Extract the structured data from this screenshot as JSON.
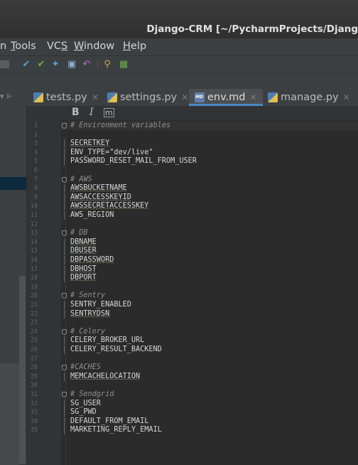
{
  "window": {
    "title": "Django-CRM [~/PycharmProjects/Djang"
  },
  "menu": [
    {
      "label": "n",
      "u": ""
    },
    {
      "label": "Tools",
      "u": "T"
    },
    {
      "label": "VCS",
      "u": "S"
    },
    {
      "label": "Window",
      "u": "W"
    },
    {
      "label": "Help",
      "u": "H"
    }
  ],
  "toolbar_icons": [
    "vcs-update-icon",
    "vcs-commit-icon",
    "vcs-push-icon",
    "vcs-history-icon",
    "vcs-revert-icon",
    "pull-request-icon",
    "shelve-icon"
  ],
  "tabs": [
    {
      "label": "tests.py",
      "type": "py",
      "active": false
    },
    {
      "label": "settings.py",
      "type": "py",
      "active": false
    },
    {
      "label": "env.md",
      "type": "md",
      "active": true
    },
    {
      "label": "manage.py",
      "type": "py",
      "active": false
    }
  ],
  "md_toolbar": {
    "bold": "B",
    "italic": "I",
    "code": "m"
  },
  "editor": {
    "lines": [
      {
        "n": "1",
        "t": "# Environment variables",
        "k": "hdr"
      },
      {
        "n": "2",
        "t": "",
        "k": ""
      },
      {
        "n": "3",
        "t": "SECRETKEY",
        "k": "key"
      },
      {
        "n": "4",
        "t": "ENV_TYPE=\"dev/live\"",
        "k": "key"
      },
      {
        "n": "5",
        "t": "PASSWORD_RESET_MAIL_FROM_USER",
        "k": "key"
      },
      {
        "n": "6",
        "t": "",
        "k": ""
      },
      {
        "n": "7",
        "t": "# AWS",
        "k": "hdr"
      },
      {
        "n": "8",
        "t": "AWSBUCKETNAME",
        "k": "key"
      },
      {
        "n": "9",
        "t": "AWSACCESSKEYID",
        "k": "key"
      },
      {
        "n": "10",
        "t": "AWSSECRETACCESSKEY",
        "k": "key"
      },
      {
        "n": "11",
        "t": "AWS_REGION",
        "k": "key"
      },
      {
        "n": "12",
        "t": "",
        "k": ""
      },
      {
        "n": "13",
        "t": "# DB",
        "k": "hdr"
      },
      {
        "n": "14",
        "t": "DBNAME",
        "k": "key"
      },
      {
        "n": "15",
        "t": "DBUSER",
        "k": "key"
      },
      {
        "n": "16",
        "t": "DBPASSWORD",
        "k": "key"
      },
      {
        "n": "17",
        "t": "DBHOST",
        "k": "key"
      },
      {
        "n": "18",
        "t": "DBPORT",
        "k": "key"
      },
      {
        "n": "19",
        "t": "",
        "k": ""
      },
      {
        "n": "20",
        "t": "# Sentry",
        "k": "hdr"
      },
      {
        "n": "21",
        "t": "SENTRY_ENABLED",
        "k": "key"
      },
      {
        "n": "22",
        "t": "SENTRYDSN",
        "k": "key"
      },
      {
        "n": "23",
        "t": "",
        "k": ""
      },
      {
        "n": "24",
        "t": "# Celery",
        "k": "hdr"
      },
      {
        "n": "25",
        "t": "CELERY_BROKER_URL",
        "k": "key"
      },
      {
        "n": "26",
        "t": "CELERY_RESULT_BACKEND",
        "k": "key"
      },
      {
        "n": "27",
        "t": "",
        "k": ""
      },
      {
        "n": "28",
        "t": "#CACHES",
        "k": "hdr"
      },
      {
        "n": "29",
        "t": "MEMCACHELOCATION",
        "k": "key"
      },
      {
        "n": "30",
        "t": "",
        "k": ""
      },
      {
        "n": "31",
        "t": "# Sendgrid",
        "k": "hdr"
      },
      {
        "n": "32",
        "t": "SG_USER",
        "k": "key"
      },
      {
        "n": "33",
        "t": "SG_PWD",
        "k": "key"
      },
      {
        "n": "34",
        "t": "DEFAULT_FROM_EMAIL",
        "k": "key"
      },
      {
        "n": "35",
        "t": "MARKETING_REPLY_EMAIL",
        "k": "key"
      }
    ]
  },
  "colors": {
    "accent": "#4a88c7",
    "header_text": "#8f8f8f",
    "text": "#d7d7d7",
    "background": "#2b2b2b"
  }
}
